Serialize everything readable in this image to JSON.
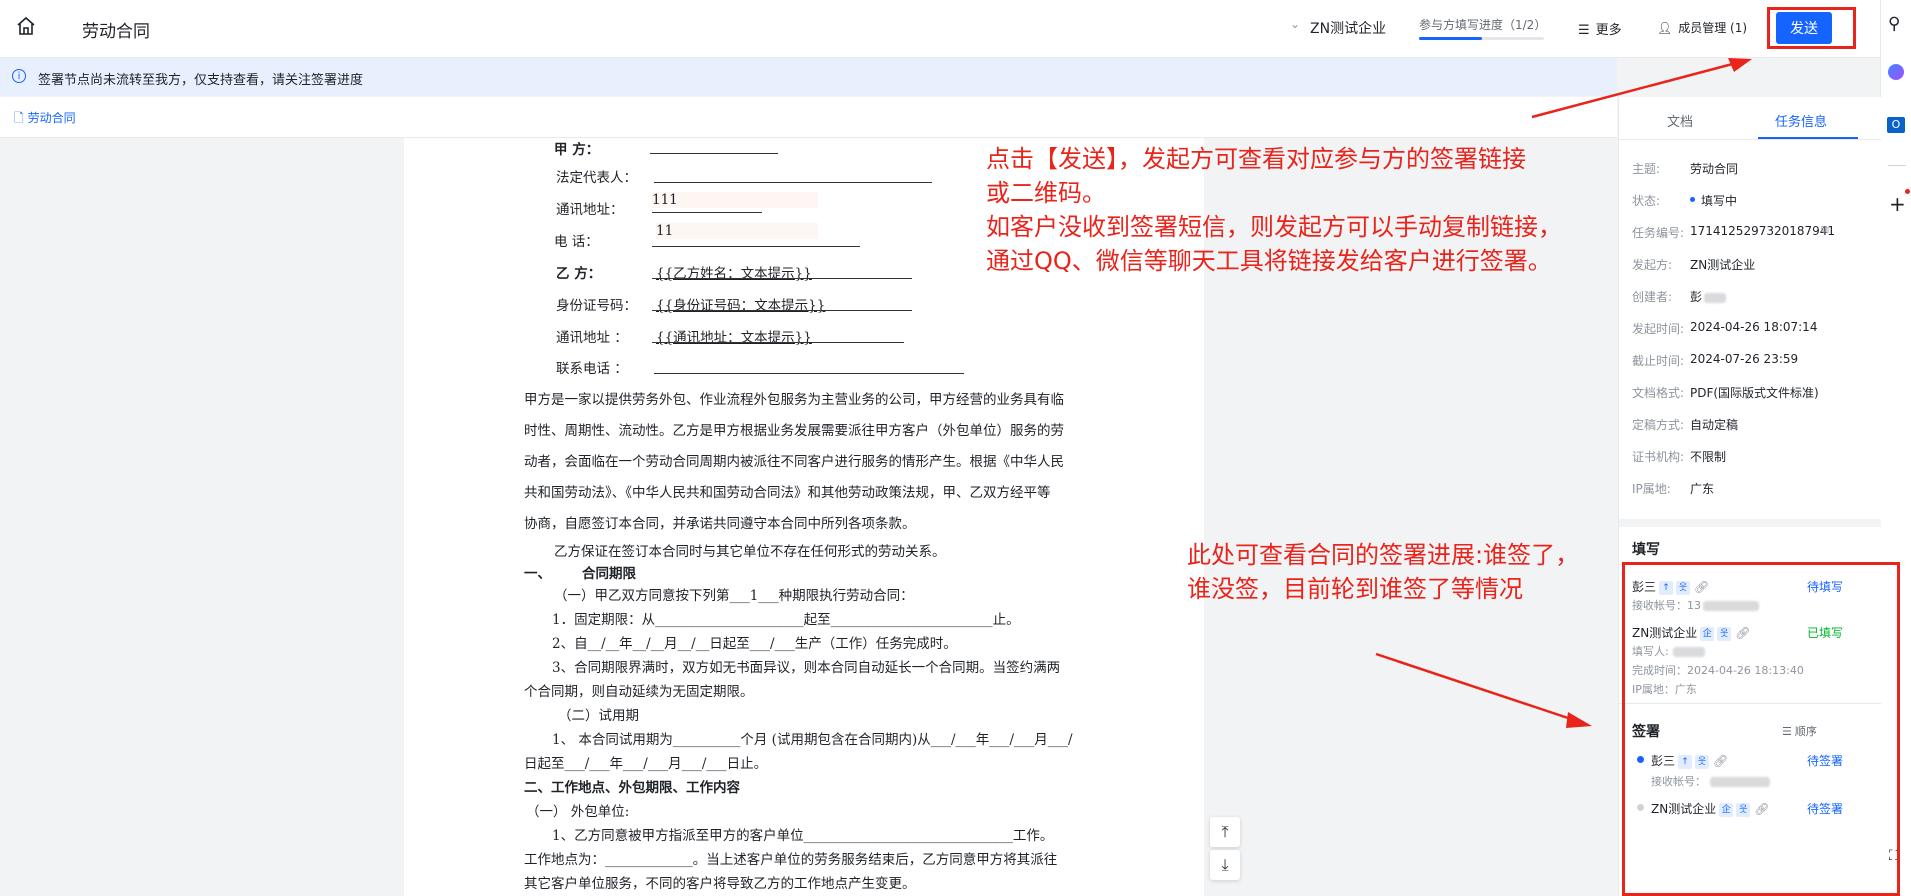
{
  "header": {
    "title": "劳动合同",
    "company": "ZN测试企业",
    "progress_label": "参与方填写进度（1/2）",
    "progress_fraction": 0.5,
    "more_label": "更多",
    "members_label": "成员管理 (1)",
    "send_label": "发送"
  },
  "notice": {
    "text": "签署节点尚未流转至我方，仅支持查看，请关注签署进度"
  },
  "doc_tab": {
    "label": "劳动合同"
  },
  "document": {
    "party_a": "甲 方：",
    "legal_rep": "法定代表人：",
    "address_a": "通讯地址：",
    "address_a_value": "111",
    "phone_a": "电 话：",
    "phone_a_value": "11",
    "party_b": "乙 方：",
    "party_b_value": "{{乙方姓名：文本提示}}",
    "id_no": "身份证号码：",
    "id_no_value": "{{身份证号码：文本提示}}",
    "address_b": "通讯地址 ：",
    "address_b_value": "{{通讯地址：文本提示}}",
    "phone_b": "联系电话 ：",
    "intro_lines": [
      "甲方是一家以提供劳务外包、作业流程外包服务为主营业务的公司，甲方经营的业务具有临",
      "时性、周期性、流动性。乙方是甲方根据业务发展需要派往甲方客户（外包单位）服务的劳",
      "动者，会面临在一个劳动合同周期内被派往不同客户进行服务的情形产生。根据《中华人民",
      "共和国劳动法》、《中华人民共和国劳动合同法》和其他劳动政策法规，甲、乙双方经平等",
      "协商，自愿签订本合同，并承诺共同遵守本合同中所列各项条款。"
    ],
    "guarantee": "乙方保证在签订本合同时与其它单位不存在任何形式的劳动关系。",
    "sec1_no": "一、",
    "sec1_title": "合同期限",
    "term_a": "（一）甲乙双方同意按下列第___1___种期限执行劳动合同：",
    "term_1": "1．固定期限：从______________________起至________________________止。",
    "term_2": "2、自__/__年__/__月__/__日起至___/___生产（工作）任务完成时。",
    "term_3a": "3、合同期限界满时，双方如无书面异议，则本合同自动延长一个合同期。当签约满两",
    "term_3b": "个合同期，则自动延续为无固定期限。",
    "probation_title": "（二）试用期",
    "probation_a": "1、 本合同试用期为__________个月 (试用期包含在合同期内)从___/___年___/___月___/",
    "probation_b": "日起至___/___年___/___月___/___日止。",
    "sec2_title": "二、工作地点、外包期限、工作内容",
    "sec2_sub": "（一） 外包单位:",
    "sec2_a": "1、乙方同意被甲方指派至甲方的客户单位_______________________________工作。",
    "sec2_b": "工作地点为：_____________。当上述客户单位的劳务服务结束后，乙方同意甲方将其派往",
    "sec2_c": "其它客户单位服务，不同的客户将导致乙方的工作地点产生变更。"
  },
  "annotations": {
    "top_lines": [
      "点击【发送】，发起方可查看对应参与方的签署链接",
      "或二维码。",
      "如客户没收到签署短信，则发起方可以手动复制链接，",
      "通过QQ、微信等聊天工具将链接发给客户进行签署。"
    ],
    "mid_lines": [
      "此处可查看合同的签署进展:谁签了，",
      "谁没签，目前轮到谁签了等情况"
    ]
  },
  "panel": {
    "tab_doc": "文档",
    "tab_task": "任务信息",
    "fields": [
      {
        "k": "主题:",
        "v": "劳动合同"
      },
      {
        "k": "状态:",
        "v": "填写中"
      },
      {
        "k": "任务编号:",
        "v": "1714125297320187941"
      },
      {
        "k": "发起方:",
        "v": "ZN测试企业"
      },
      {
        "k": "创建者:",
        "v": "彭"
      },
      {
        "k": "发起时间:",
        "v": "2024-04-26 18:07:14"
      },
      {
        "k": "截止时间:",
        "v": "2024-07-26 23:59"
      },
      {
        "k": "文档格式:",
        "v": "PDF(国际版式文件标准)"
      },
      {
        "k": "定稿方式:",
        "v": "自动定稿"
      },
      {
        "k": "证书机构:",
        "v": "不限制"
      },
      {
        "k": "IP属地:",
        "v": "广东"
      }
    ],
    "fill_title": "填写",
    "fill_entries": [
      {
        "name": "彭三",
        "status": "待填写",
        "line1": "接收帐号：13"
      },
      {
        "name": "ZN测试企业",
        "status": "已填写",
        "line1": "填写人:",
        "line2": "完成时间：2024-04-26 18:13:40",
        "line3": "IP属地：广东"
      }
    ],
    "sign_title": "签署",
    "sign_order": "顺序",
    "sign_entries": [
      {
        "name": "彭三",
        "status": "待签署",
        "line1": "接收帐号："
      },
      {
        "name": "ZN测试企业",
        "status": "待签署"
      }
    ]
  },
  "colors": {
    "accent": "#1664ff",
    "annotation": "#e8241b",
    "done": "#00b42a"
  }
}
